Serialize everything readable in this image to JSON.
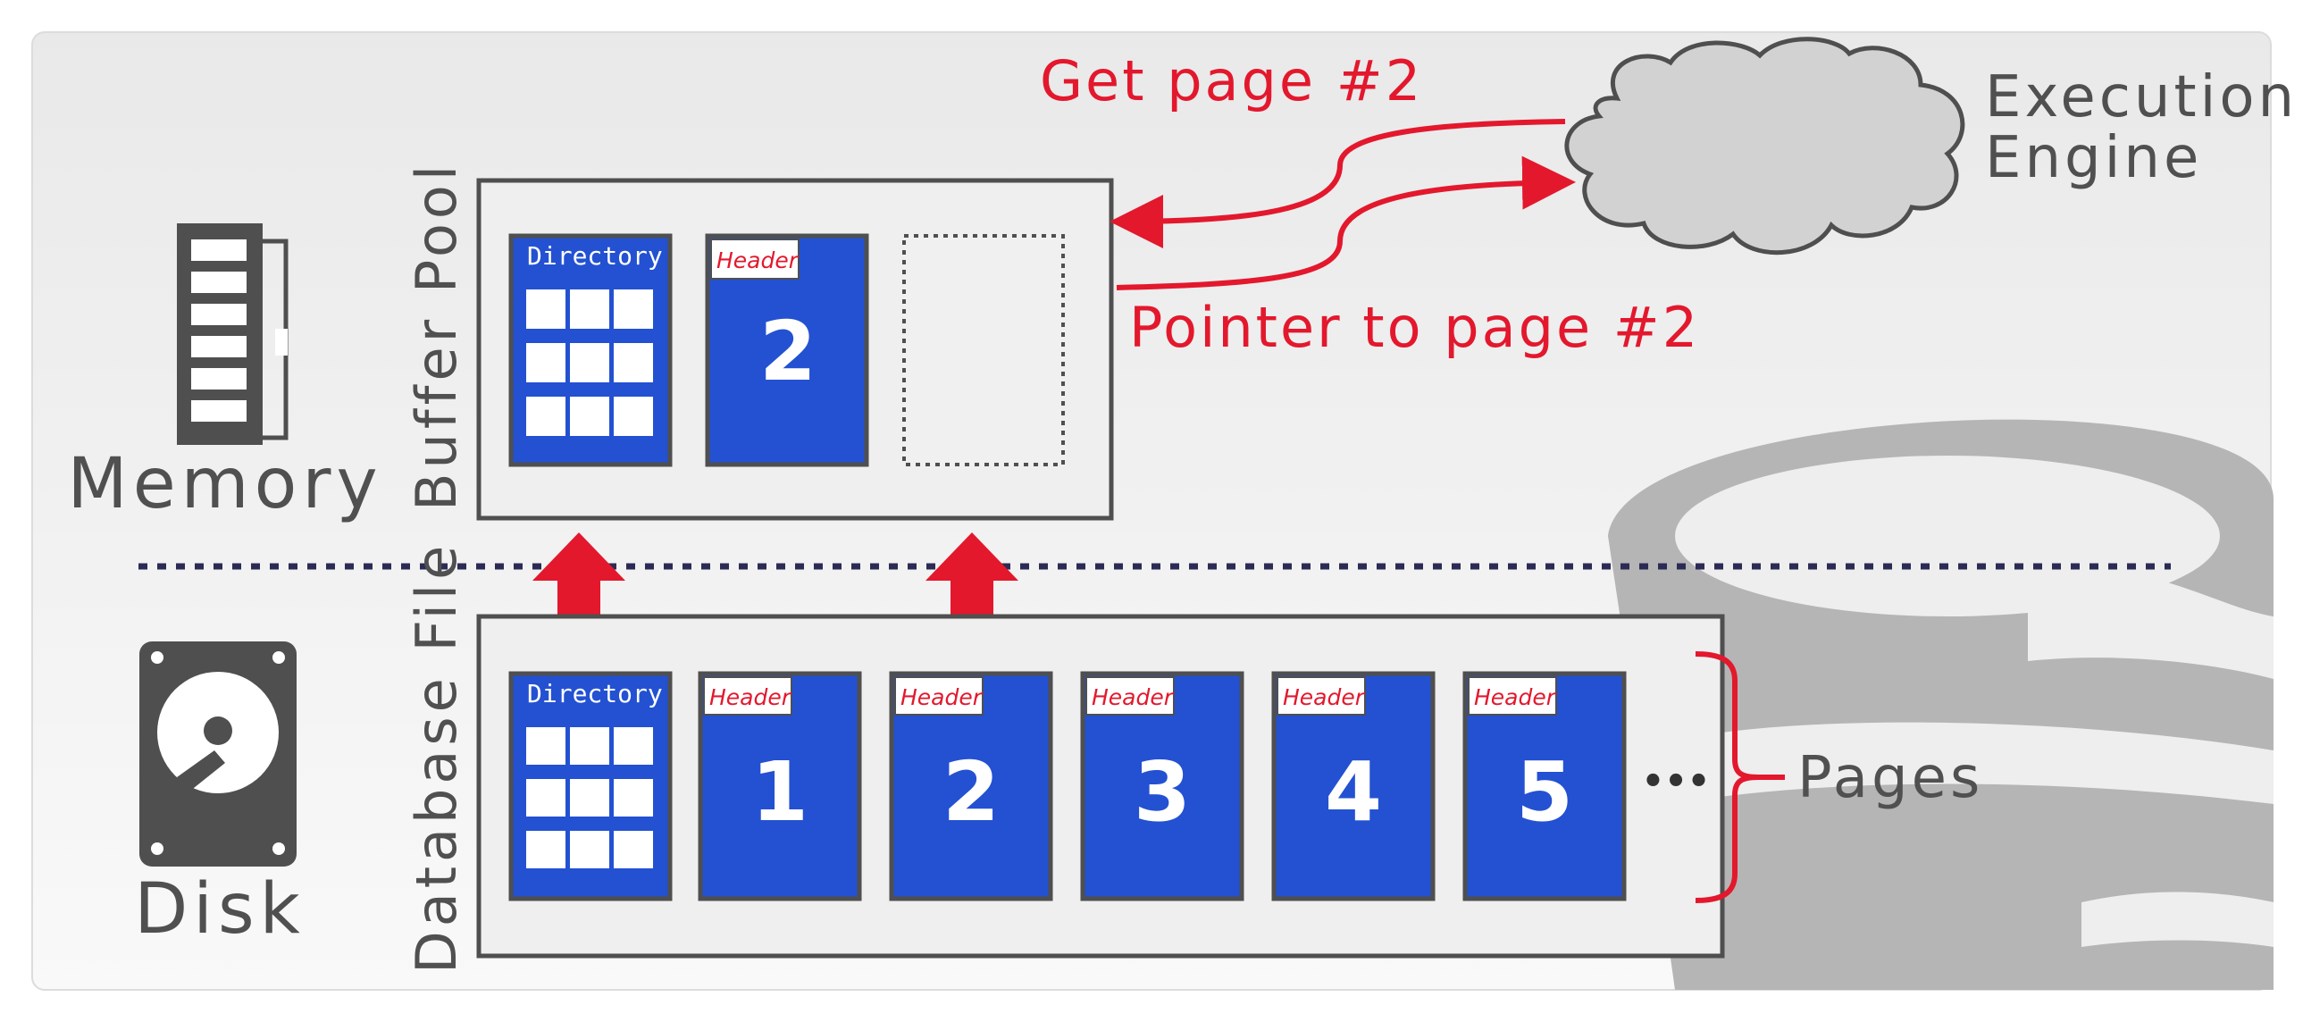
{
  "labels": {
    "memory": "Memory",
    "disk": "Disk",
    "buffer_pool": "Buffer Pool",
    "database_file": "Database File",
    "execution_engine_line1": "Execution",
    "execution_engine_line2": "Engine",
    "get_page": "Get page #2",
    "pointer_to_page": "Pointer to page #2",
    "pages": "Pages",
    "ellipsis": "•••"
  },
  "buffer_pool": {
    "directory_label": "Directory",
    "page": {
      "header": "Header",
      "number": "2"
    }
  },
  "database_file": {
    "directory_label": "Directory",
    "pages": [
      {
        "header": "Header",
        "number": "1"
      },
      {
        "header": "Header",
        "number": "2"
      },
      {
        "header": "Header",
        "number": "3"
      },
      {
        "header": "Header",
        "number": "4"
      },
      {
        "header": "Header",
        "number": "5"
      }
    ]
  },
  "colors": {
    "page_blue": "#2351d2",
    "accent_red": "#e3182d",
    "icon_grey": "#4f4f4f",
    "panel_bg": "#efefef",
    "cloud_fill": "#d2d2d2",
    "divider": "#2b2b55"
  },
  "icons": [
    "memory-chip-icon",
    "hard-disk-icon",
    "cloud-icon",
    "database-cylinder-icon"
  ]
}
